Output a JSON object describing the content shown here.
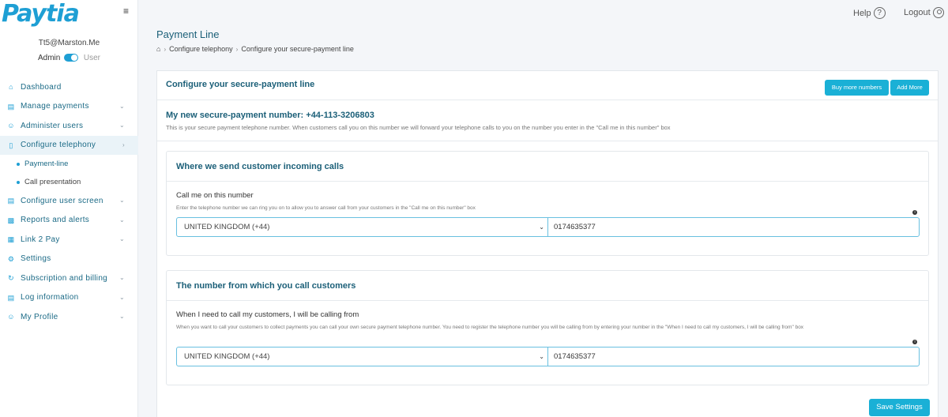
{
  "brand": {
    "logo_text": "Paytia",
    "accent": "#1e9fd4",
    "button_color": "#1ab0d6",
    "title_color": "#1b5f78"
  },
  "sidebar": {
    "user_email": "Tt5@Marston.Me",
    "role_admin": "Admin",
    "role_user": "User",
    "items": [
      {
        "label": "Dashboard",
        "icon": "home-icon"
      },
      {
        "label": "Manage payments",
        "icon": "card-icon"
      },
      {
        "label": "Administer users",
        "icon": "user-icon"
      },
      {
        "label": "Configure telephony",
        "icon": "phone-icon"
      },
      {
        "label": "Configure user screen",
        "icon": "screen-icon"
      },
      {
        "label": "Reports and alerts",
        "icon": "chart-icon"
      },
      {
        "label": "Link 2 Pay",
        "icon": "grid-icon"
      },
      {
        "label": "Settings",
        "icon": "gear-icon"
      },
      {
        "label": "Subscription and billing",
        "icon": "refresh-icon"
      },
      {
        "label": "Log information",
        "icon": "document-icon"
      },
      {
        "label": "My Profile",
        "icon": "profile-icon"
      }
    ],
    "sub_items": [
      {
        "label": "Payment-line"
      },
      {
        "label": "Call presentation"
      }
    ]
  },
  "topbar": {
    "help_label": "Help",
    "logout_label": "Logout"
  },
  "page": {
    "title": "Payment Line",
    "breadcrumb": [
      "Configure telephony",
      "Configure your secure-payment line"
    ]
  },
  "card": {
    "title": "Configure your secure-payment line",
    "buy_more_label": "Buy more numbers",
    "add_more_label": "Add More",
    "number_title": "My new secure-payment number: +44-113-3206803",
    "number_desc": "This is your secure payment telephone number. When customers call you on this number we will forward your telephone calls to you on the number you enter in the \"Call me in this number\" box"
  },
  "incoming": {
    "title": "Where we send customer incoming calls",
    "label": "Call me on this number",
    "help": "Enter the telephone number we can ring you on to allow you to answer call from your customers in the \"Call me on this number\" box",
    "country": "UNITED KINGDOM (+44)",
    "phone": "0174635377"
  },
  "outgoing": {
    "title": "The number from which you call customers",
    "label": "When I need to call my customers, I will be calling from",
    "help": "When you want to call your customers to collect payments you can call your own secure payment telephone number. You need to register the telephone number you will be calling from by entering your number in the \"When I need to call my customers, I will be calling from\" box",
    "country": "UNITED KINGDOM (+44)",
    "phone": "0174635377"
  },
  "save_label": "Save Settings"
}
